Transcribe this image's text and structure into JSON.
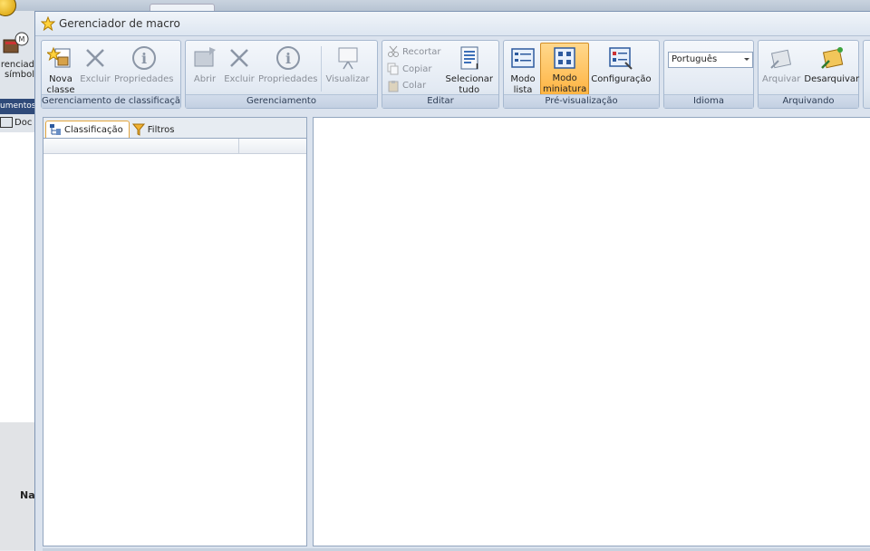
{
  "background": {
    "label_line1": "renciad",
    "label_line2": "símbol",
    "strip": "umentos",
    "doc": "Doc",
    "na": "Na"
  },
  "window": {
    "title": "Gerenciador de macro"
  },
  "ribbon": {
    "groups": [
      {
        "label": "Gerenciamento de classificação",
        "buttons": [
          {
            "line1": "Nova",
            "line2": "classe",
            "icon": "new-class-icon"
          },
          {
            "line1": "Excluir",
            "icon": "delete-icon"
          },
          {
            "line1": "Propriedades",
            "icon": "info-icon"
          }
        ]
      },
      {
        "label": "Gerenciamento",
        "buttons": [
          {
            "line1": "Abrir",
            "icon": "open-icon"
          },
          {
            "line1": "Excluir",
            "icon": "delete-icon"
          },
          {
            "line1": "Propriedades",
            "icon": "info-icon"
          },
          {
            "line1": "Visualizar",
            "icon": "presentation-icon"
          }
        ]
      },
      {
        "label": "Editar",
        "small": [
          "Recortar",
          "Copiar",
          "Colar"
        ],
        "buttons": [
          {
            "line1": "Selecionar",
            "line2": "tudo",
            "icon": "select-all-icon"
          }
        ]
      },
      {
        "label": "Pré-visualização",
        "buttons": [
          {
            "line1": "Modo",
            "line2": "lista",
            "icon": "list-mode-icon"
          },
          {
            "line1": "Modo",
            "line2": "miniatura",
            "icon": "thumbnail-mode-icon"
          },
          {
            "line1": "Configuração",
            "icon": "configuration-icon"
          }
        ]
      },
      {
        "label": "Idioma",
        "select_value": "Português"
      },
      {
        "label": "Arquivando",
        "buttons": [
          {
            "line1": "Arquivar",
            "icon": "archive-icon"
          },
          {
            "line1": "Desarquivar",
            "icon": "unarchive-icon"
          }
        ]
      }
    ]
  },
  "left_pane": {
    "tabs": [
      {
        "label": "Classificação",
        "icon": "classification-icon"
      },
      {
        "label": "Filtros",
        "icon": "filter-icon"
      }
    ]
  },
  "colors": {
    "accent": "#ffb443",
    "ribbon_border": "#a7b9d0",
    "strip": "#2f4a79"
  }
}
